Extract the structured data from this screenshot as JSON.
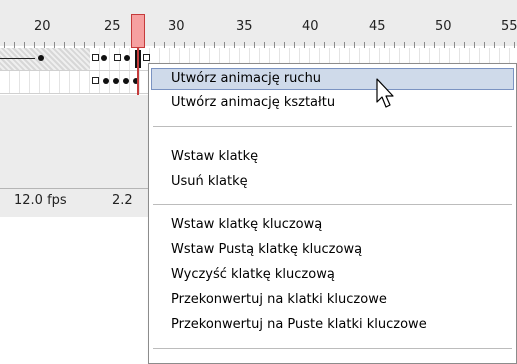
{
  "timeline": {
    "ruler_numbers": [
      "20",
      "25",
      "30",
      "35",
      "40",
      "45",
      "50",
      "55"
    ],
    "playhead_frame": "26",
    "fps": "12.0 fps",
    "elapsed": "2.2"
  },
  "menu": {
    "groups": [
      [
        {
          "label": "Utwórz animację ruchu",
          "highlighted": true
        },
        {
          "label": "Utwórz animację kształtu",
          "highlighted": false
        }
      ],
      [
        {
          "label": "Wstaw klatkę",
          "highlighted": false
        },
        {
          "label": "Usuń klatkę",
          "highlighted": false
        }
      ],
      [
        {
          "label": "Wstaw klatkę kluczową",
          "highlighted": false
        },
        {
          "label": "Wstaw Pustą klatkę kluczową",
          "highlighted": false
        },
        {
          "label": "Wyczyść klatkę kluczową",
          "highlighted": false
        },
        {
          "label": "Przekonwertuj na klatki kluczowe",
          "highlighted": false
        },
        {
          "label": "Przekonwertuj na Puste klatki kluczowe",
          "highlighted": false
        }
      ]
    ]
  },
  "icons": {
    "cursor": "arrow-cursor-icon",
    "keyframe": "keyframe-dot-icon",
    "empty_keyframe": "empty-keyframe-icon"
  },
  "colors": {
    "playhead": "#c53b3b",
    "menu_highlight": "#cfdaea",
    "menu_highlight_border": "#7b93c2"
  }
}
